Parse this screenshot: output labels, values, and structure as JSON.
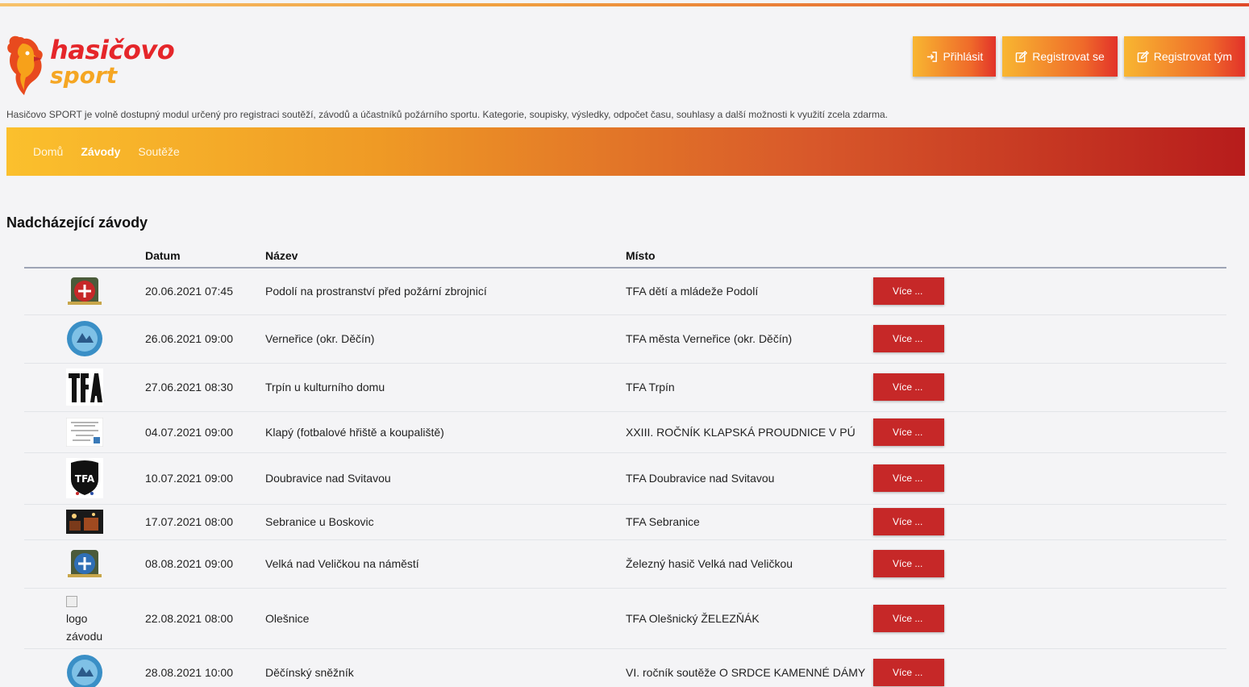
{
  "header": {
    "logo_text_1": "hasičovo",
    "logo_text_2": "sport",
    "buttons": {
      "login": "Přihlásit",
      "register": "Registrovat se",
      "register_team": "Registrovat tým"
    },
    "intro": "Hasičovo SPORT je volně dostupný modul určený pro registraci soutěží, závodů a účastníků požárního sportu. Kategorie, soupisky, výsledky, odpočet času, souhlasy a další možnosti k využití zcela zdarma."
  },
  "nav": {
    "home": "Domů",
    "races": "Závody",
    "competitions": "Soutěže"
  },
  "section_title": "Nadcházející závody",
  "table": {
    "headers": {
      "date": "Datum",
      "name": "Název",
      "place": "Místo"
    },
    "more_label": "Více ...",
    "broken_logo_alt": "logo závodu",
    "rows": [
      {
        "date": "20.06.2021 07:45",
        "name": "Podolí na prostranství před požární zbrojnicí",
        "place": "TFA dětí a mládeže Podolí",
        "logo": "crest-red-icon"
      },
      {
        "date": "26.06.2021 09:00",
        "name": "Verneřice (okr. Děčín)",
        "place": "TFA města Verneřice (okr. Děčín)",
        "logo": "blue-round-badge-icon"
      },
      {
        "date": "27.06.2021 08:30",
        "name": "Trpín u kulturního domu",
        "place": "TFA Trpín",
        "logo": "tfa-text-logo-icon"
      },
      {
        "date": "04.07.2021 09:00",
        "name": "Klapý (fotbalové hřiště a koupaliště)",
        "place": "XXIII. ROČNÍK KLAPSKÁ PROUDNICE V PÚ",
        "logo": "flyer-thumbnail-icon"
      },
      {
        "date": "10.07.2021 09:00",
        "name": "Doubravice nad Svitavou",
        "place": "TFA Doubravice nad Svitavou",
        "logo": "tfa-shield-logo-icon"
      },
      {
        "date": "17.07.2021 08:00",
        "name": "Sebranice u Boskovic",
        "place": "TFA Sebranice",
        "logo": "night-photo-icon"
      },
      {
        "date": "08.08.2021 09:00",
        "name": "Velká nad Veličkou na náměstí",
        "place": "Železný hasič Velká nad Veličkou",
        "logo": "crest-blue-icon"
      },
      {
        "date": "22.08.2021 08:00",
        "name": "Olešnice",
        "place": "TFA Olešnický ŽELEZŇÁK",
        "logo": "broken-image-icon"
      },
      {
        "date": "28.08.2021 10:00",
        "name": "Děčínský sněžník",
        "place": "VI. ročník soutěže O SRDCE KAMENNÉ DÁMY",
        "logo": "blue-round-badge-icon"
      }
    ]
  }
}
